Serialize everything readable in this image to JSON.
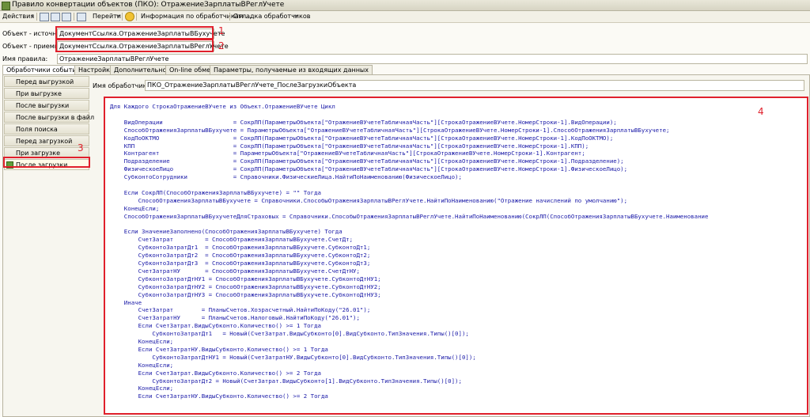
{
  "window": {
    "title": "Правило конвертации объектов (ПКО): ОтражениеЗарплатыВРеглУчете"
  },
  "toolbar": {
    "actions": "Действия",
    "navigate": "Перейти",
    "info": "Информация по обработчикам ...",
    "debug": "Отладка обработчиков"
  },
  "form": {
    "source_label": "Объект - источник:",
    "source_value": "ДокументСсылка.ОтражениеЗарплатыВБухучете",
    "receiver_label": "Объект - приемник:",
    "receiver_value": "ДокументСсылка.ОтражениеЗарплатыВРеглУчете",
    "rule_label": "Имя правила:",
    "rule_value": "ОтражениеЗарплатыВРеглУчете"
  },
  "annotations": [
    "1",
    "2",
    "3",
    "4"
  ],
  "tabs": [
    "Обработчики событий",
    "Настройки",
    "Дополнительно",
    "On-line обмен",
    "Параметры, получаемые из входящих данных"
  ],
  "sidebar": {
    "items": [
      "Перед выгрузкой",
      "При выгрузке",
      "После выгрузки",
      "После выгрузки в файл",
      "Поля поиска",
      "Перед загрузкой",
      "При загрузке",
      "После загрузки"
    ]
  },
  "handler": {
    "label": "Имя обработчика:",
    "value": "ПКО_ОтражениеЗарплатыВРеглУчете_ПослеЗагрузкиОбъекта"
  },
  "code": {
    "lines": [
      "Для Каждого СтрокаОтражениеВУчете из Объект.ОтражениеВУчете Цикл",
      "",
      "    ВидОперации                    = СокрЛП(ПараметрыОбъекта[\"ОтражениеВУчетеТабличнаяЧасть\"][СтрокаОтражениеВУчете.НомерСтроки-1].ВидОперации);",
      "    СпособОтраженияЗарплатыВБухучете = ПараметрыОбъекта[\"ОтражениеВУчетеТабличнаяЧасть\"][СтрокаОтражениеВУчете.НомерСтроки-1].СпособОтраженияЗарплатыВБухучете;",
      "    КодПоОКТМО                     = СокрЛП(ПараметрыОбъекта[\"ОтражениеВУчетеТабличнаяЧасть\"][СтрокаОтражениеВУчете.НомерСтроки-1].КодПоОКТМО);",
      "    КПП                            = СокрЛП(ПараметрыОбъекта[\"ОтражениеВУчетеТабличнаяЧасть\"][СтрокаОтражениеВУчете.НомерСтроки-1].КПП);",
      "    Контрагент                     = ПараметрыОбъекта[\"ОтражениеВУчетеТабличнаяЧасть\"][СтрокаОтражениеВУчете.НомерСтроки-1].Контрагент;",
      "    Подразделение                  = СокрЛП(ПараметрыОбъекта[\"ОтражениеВУчетеТабличнаяЧасть\"][СтрокаОтражениеВУчете.НомерСтроки-1].Подразделение);",
      "    ФизическоеЛицо                 = СокрЛП(ПараметрыОбъекта[\"ОтражениеВУчетеТабличнаяЧасть\"][СтрокаОтражениеВУчете.НомерСтроки-1].ФизическоеЛицо);",
      "    СубконтоСотрудники             = Справочники.ФизическиеЛица.НайтиПоНаименованию(ФизическоеЛицо);",
      "",
      "    Если СокрЛП(СпособОтраженияЗарплатыВБухучете) = \"\" Тогда",
      "        СпособОтраженияЗарплатыВБухучете = Справочники.СпособыОтраженияЗарплатыВРеглУчете.НайтиПоНаименованию(\"Отражение начислений по умолчанию\");",
      "    КонецЕсли;",
      "    СпособОтраженияЗарплатыВБухучетеДляСтраховых = Справочники.СпособыОтраженияЗарплатыВРеглУчете.НайтиПоНаименованию(СокрЛП(СпособОтраженияЗарплатыВБухучете.Наименование",
      "",
      "    Если ЗначениеЗаполнено(СпособОтраженияЗарплатыВБухучете) Тогда",
      "        СчетЗатрат         = СпособОтраженияЗарплатыВБухучете.СчетДт;",
      "        СубконтоЗатратДт1  = СпособОтраженияЗарплатыВБухучете.СубконтоДт1;",
      "        СубконтоЗатратДт2  = СпособОтраженияЗарплатыВБухучете.СубконтоДт2;",
      "        СубконтоЗатратДт3  = СпособОтраженияЗарплатыВБухучете.СубконтоДт3;",
      "        СчетЗатратНУ       = СпособОтраженияЗарплатыВБухучете.СчетДтНУ;",
      "        СубконтоЗатратДтНУ1 = СпособОтраженияЗарплатыВБухучете.СубконтоДтНУ1;",
      "        СубконтоЗатратДтНУ2 = СпособОтраженияЗарплатыВБухучете.СубконтоДтНУ2;",
      "        СубконтоЗатратДтНУ3 = СпособОтраженияЗарплатыВБухучете.СубконтоДтНУ3;",
      "    Иначе",
      "        СчетЗатрат        = ПланыСчетов.Хозрасчетный.НайтиПоКоду(\"26.01\");",
      "        СчетЗатратНУ      = ПланыСчетов.Налоговый.НайтиПоКоду(\"26.01\");",
      "        Если СчетЗатрат.ВидыСубконто.Количество() >= 1 Тогда",
      "            СубконтоЗатратДт1   = Новый(СчетЗатрат.ВидыСубконто[0].ВидСубконто.ТипЗначения.Типы()[0]);",
      "        КонецЕсли;",
      "        Если СчетЗатратНУ.ВидыСубконто.Количество() >= 1 Тогда",
      "            СубконтоЗатратДтНУ1 = Новый(СчетЗатратНУ.ВидыСубконто[0].ВидСубконто.ТипЗначения.Типы()[0]);",
      "        КонецЕсли;",
      "        Если СчетЗатрат.ВидыСубконто.Количество() >= 2 Тогда",
      "            СубконтоЗатратДт2 = Новый(СчетЗатрат.ВидыСубконто[1].ВидСубконто.ТипЗначения.Типы()[0]);",
      "        КонецЕсли;",
      "        Если СчетЗатратНУ.ВидыСубконто.Количество() >= 2 Тогда"
    ]
  }
}
